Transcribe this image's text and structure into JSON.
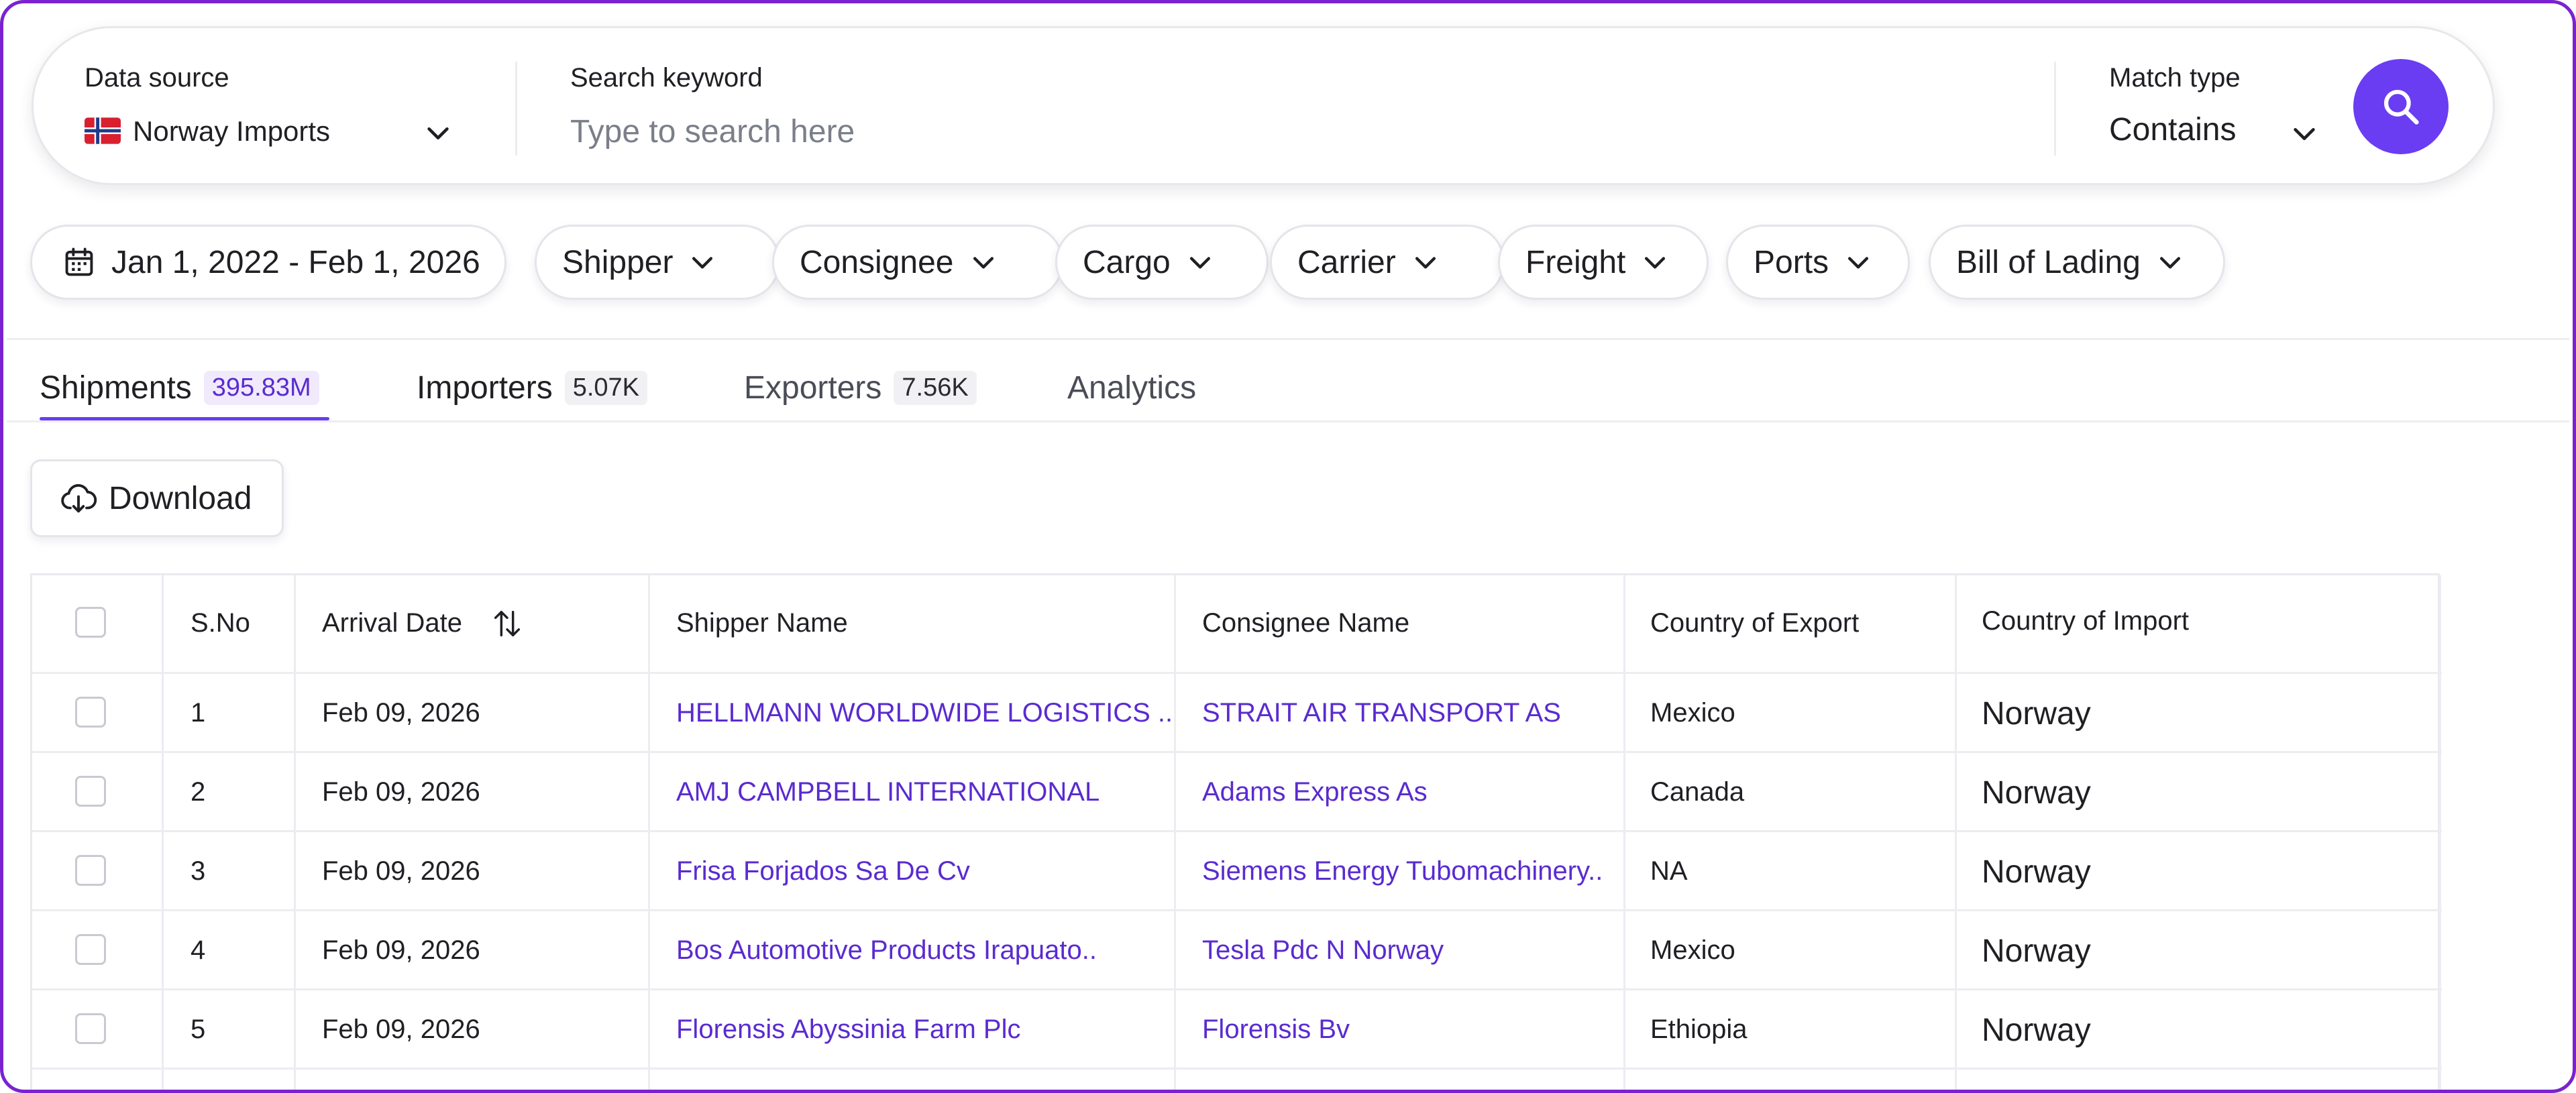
{
  "search": {
    "data_source_label": "Data source",
    "data_source_value": "Norway Imports",
    "data_source_flag_icon": "norway-flag-icon",
    "keyword_label": "Search keyword",
    "keyword_placeholder": "Type to search here",
    "keyword_value": "",
    "match_type_label": "Match type",
    "match_type_value": "Contains",
    "search_button_icon": "search-icon",
    "accent_color": "#6a3df2"
  },
  "filters": {
    "date_range": "Jan 1, 2022 - Feb 1, 2026",
    "date_icon": "calendar-icon",
    "chips": [
      "Shipper",
      "Consignee",
      "Cargo",
      "Carrier",
      "Freight",
      "Ports",
      "Bill of Lading"
    ]
  },
  "tabs": [
    {
      "label": "Shipments",
      "count": "395.83M",
      "active": true
    },
    {
      "label": "Importers",
      "count": "5.07K",
      "active": false
    },
    {
      "label": "Exporters",
      "count": "7.56K",
      "active": false
    },
    {
      "label": "Analytics",
      "count": "",
      "active": false
    }
  ],
  "toolbar": {
    "download_label": "Download",
    "download_icon": "cloud-download-icon"
  },
  "table": {
    "columns": [
      "S.No",
      "Arrival Date",
      "Shipper Name",
      "Consignee Name",
      "Country of Export",
      "Country of Import"
    ],
    "sort_icon": "sort-arrows-icon",
    "link_color": "#5a2bd0",
    "rows": [
      {
        "sno": "1",
        "date": "Feb 09, 2026",
        "shipper": "HELLMANN WORLDWIDE LOGISTICS ..",
        "consignee": "STRAIT AIR TRANSPORT AS",
        "export": "Mexico",
        "import": "Norway"
      },
      {
        "sno": "2",
        "date": "Feb 09, 2026",
        "shipper": "AMJ CAMPBELL INTERNATIONAL",
        "consignee": "Adams Express As",
        "export": "Canada",
        "import": "Norway"
      },
      {
        "sno": "3",
        "date": "Feb 09, 2026",
        "shipper": "Frisa Forjados Sa De Cv",
        "consignee": "Siemens Energy Tubomachinery..",
        "export": "NA",
        "import": "Norway"
      },
      {
        "sno": "4",
        "date": "Feb 09, 2026",
        "shipper": "Bos Automotive Products Irapuato..",
        "consignee": "Tesla Pdc N Norway",
        "export": "Mexico",
        "import": "Norway"
      },
      {
        "sno": "5",
        "date": "Feb 09, 2026",
        "shipper": "Florensis Abyssinia Farm Plc",
        "consignee": "Florensis Bv",
        "export": "Ethiopia",
        "import": "Norway"
      }
    ]
  }
}
